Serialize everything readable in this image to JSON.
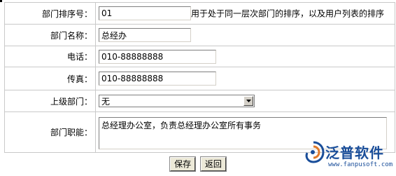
{
  "form": {
    "rows": [
      {
        "label": "部门排序号：",
        "value": "01",
        "hint": "用于处于同一层次部门的排序，以及用户列表的排序"
      },
      {
        "label": "部门名称：",
        "value": "总经办"
      },
      {
        "label": "电话：",
        "value": "010-88888888"
      },
      {
        "label": "传真：",
        "value": "010-88888888"
      },
      {
        "label": "上级部门：",
        "value": "无"
      },
      {
        "label": "部门职能：",
        "value": "总经理办公室，负责总经理办公室所有事务"
      }
    ]
  },
  "buttons": {
    "save": "保存",
    "back": "返回"
  },
  "watermark": {
    "brand": "泛普软件",
    "url": "www.fanpusoft.com",
    "color": "#1a4e9a",
    "accent": "#e0792a"
  }
}
